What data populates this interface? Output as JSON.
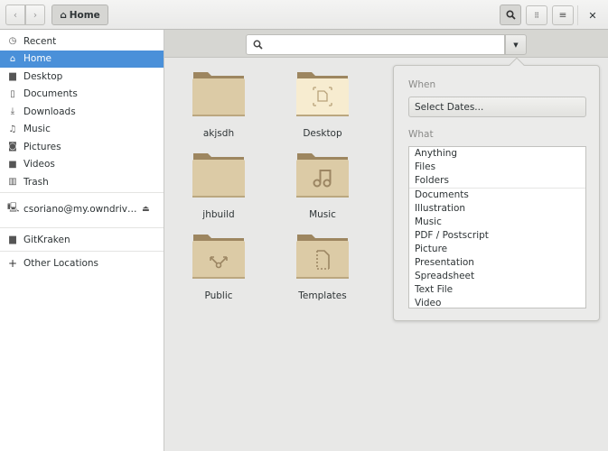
{
  "header": {
    "location": "Home",
    "icons": {
      "back": "chevron-left-icon",
      "forward": "chevron-right-icon",
      "search": "search-icon",
      "view": "grid-icon",
      "menu": "hamburger-icon",
      "close": "close-icon"
    }
  },
  "sidebar": {
    "items": [
      {
        "label": "Recent",
        "icon": "clock-icon",
        "glyph": "◷"
      },
      {
        "label": "Home",
        "icon": "home-icon",
        "glyph": "⌂",
        "selected": true
      },
      {
        "label": "Desktop",
        "icon": "folder-icon",
        "glyph": "▆"
      },
      {
        "label": "Documents",
        "icon": "document-icon",
        "glyph": "▯"
      },
      {
        "label": "Downloads",
        "icon": "download-icon",
        "glyph": "⤓"
      },
      {
        "label": "Music",
        "icon": "music-icon",
        "glyph": "♫"
      },
      {
        "label": "Pictures",
        "icon": "camera-icon",
        "glyph": "◙"
      },
      {
        "label": "Videos",
        "icon": "video-icon",
        "glyph": "■"
      },
      {
        "label": "Trash",
        "icon": "trash-icon",
        "glyph": "▥"
      }
    ],
    "network": {
      "label": "csoriano@my.owndriv…",
      "icon": "network-drive-icon",
      "eject": "eject-icon"
    },
    "bookmark": {
      "label": "GitKraken",
      "icon": "folder-icon"
    },
    "other": {
      "label": "Other Locations",
      "icon": "plus-icon"
    }
  },
  "search": {
    "value": "",
    "placeholder": ""
  },
  "files": [
    {
      "name": "akjsdh",
      "emblem": ""
    },
    {
      "name": "Desktop",
      "emblem": "desktop"
    },
    {
      "name": "jhbuild",
      "emblem": ""
    },
    {
      "name": "Music",
      "emblem": "music"
    },
    {
      "name": "Public",
      "emblem": "share"
    },
    {
      "name": "Templates",
      "emblem": "template"
    }
  ],
  "popover": {
    "when_label": "When",
    "select_dates": "Select Dates...",
    "what_label": "What",
    "what_top": [
      "Anything",
      "Files",
      "Folders"
    ],
    "what_types": [
      "Documents",
      "Illustration",
      "Music",
      "PDF / Postscript",
      "Picture",
      "Presentation",
      "Spreadsheet",
      "Text File",
      "Video"
    ]
  },
  "colors": {
    "accent": "#4a90d9",
    "folder": "#dccba6"
  }
}
